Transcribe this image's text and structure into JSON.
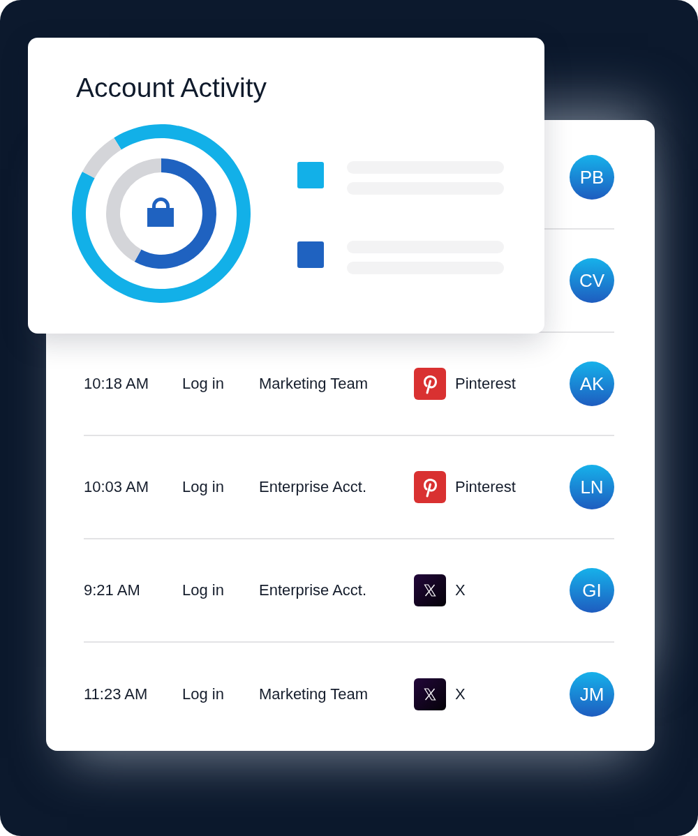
{
  "activity_card": {
    "title": "Account Activity",
    "legend": [
      {
        "color": "#12b0e8"
      },
      {
        "color": "#1f62c0"
      }
    ]
  },
  "activity_log": {
    "rows": [
      {
        "avatar": "PB"
      },
      {
        "avatar": "CV"
      },
      {
        "time": "10:18 AM",
        "action": "Log in",
        "team": "Marketing Team",
        "platform": {
          "kind": "pinterest",
          "name": "Pinterest"
        },
        "avatar": "AK"
      },
      {
        "time": "10:03 AM",
        "action": "Log in",
        "team": "Enterprise Acct.",
        "platform": {
          "kind": "pinterest",
          "name": "Pinterest"
        },
        "avatar": "LN"
      },
      {
        "time": "9:21 AM",
        "action": "Log in",
        "team": "Enterprise Acct.",
        "platform": {
          "kind": "x",
          "name": "X"
        },
        "avatar": "GI"
      },
      {
        "time": "11:23 AM",
        "action": "Log in",
        "team": "Marketing Team",
        "platform": {
          "kind": "x",
          "name": "X"
        },
        "avatar": "JM"
      }
    ]
  }
}
